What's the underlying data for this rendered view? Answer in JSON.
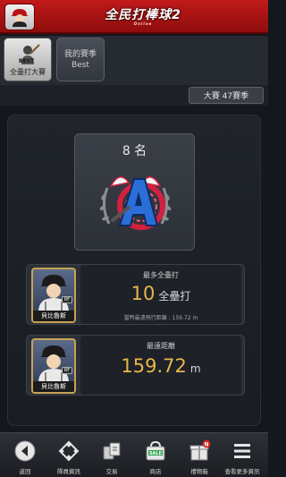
{
  "header": {
    "logo_text": "全民打棒球2",
    "logo_sub": "Online"
  },
  "tabs": [
    {
      "label": "全壘打大賽",
      "active": true
    },
    {
      "label_line1": "我的賽季",
      "label_line2": "Best",
      "active": false
    }
  ],
  "season": {
    "label": "大賽 47賽季"
  },
  "rank": {
    "label": "8 名"
  },
  "stats": [
    {
      "title": "最多全壘打",
      "value": "10",
      "unit": "全壘打",
      "sub": "當時最遠飛行距離 : 159.72 m",
      "player": {
        "name": "貝比魯斯",
        "position": "RF"
      }
    },
    {
      "title": "最遠距離",
      "value": "159.72",
      "unit": "m",
      "player": {
        "name": "貝比魯斯",
        "position": "RF"
      }
    }
  ],
  "bottom_nav": [
    {
      "label": "返回",
      "icon": "back-icon"
    },
    {
      "label": "隊員資訊",
      "icon": "diamond-icon"
    },
    {
      "label": "交易",
      "icon": "trade-icon"
    },
    {
      "label": "商店",
      "icon": "shop-icon",
      "badge": "SALE"
    },
    {
      "label": "禮物箱",
      "icon": "gift-icon",
      "badge": "N"
    },
    {
      "label": "查看更多資訊",
      "icon": "menu-icon"
    }
  ],
  "colors": {
    "header_red": "#b01414",
    "accent_gold": "#e8b64a",
    "background": "#14171d"
  }
}
